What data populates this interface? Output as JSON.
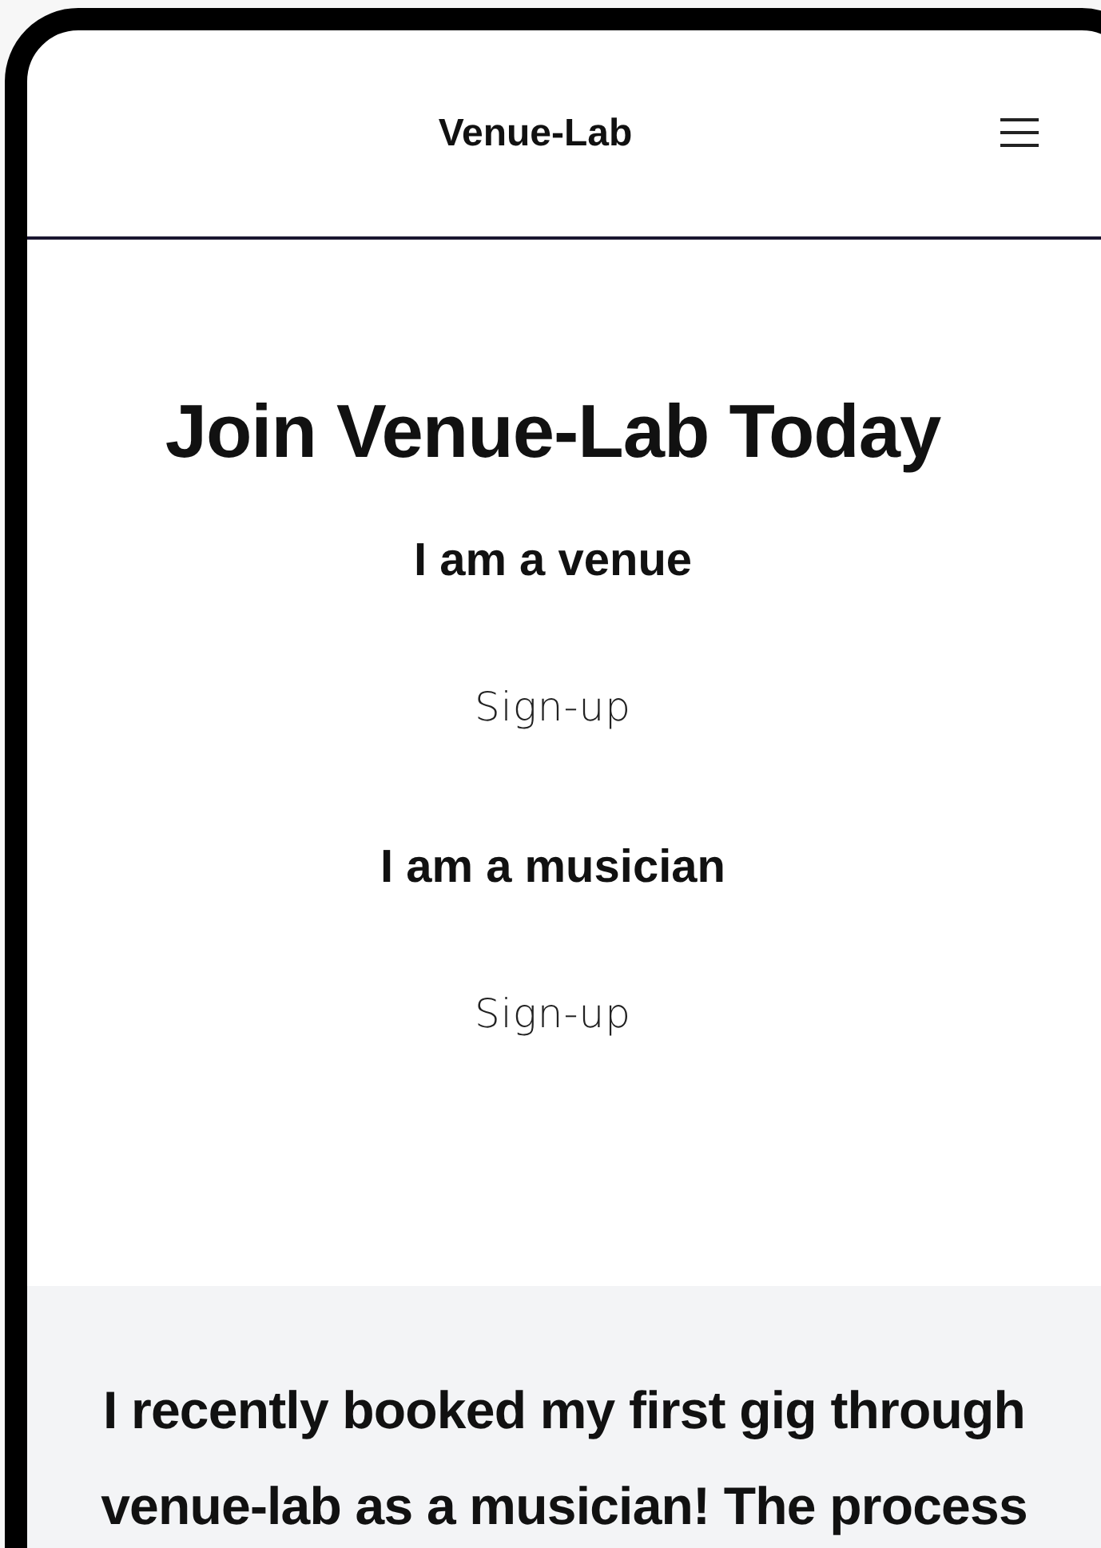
{
  "header": {
    "title": "Venue-Lab"
  },
  "signup": {
    "title": "Join Venue-Lab Today",
    "options": [
      {
        "heading": "I am a venue",
        "link": "Sign-up"
      },
      {
        "heading": "I am a musician",
        "link": "Sign-up"
      }
    ]
  },
  "testimonial": {
    "text": "I recently booked my first gig through venue-lab as a musician! The process"
  }
}
